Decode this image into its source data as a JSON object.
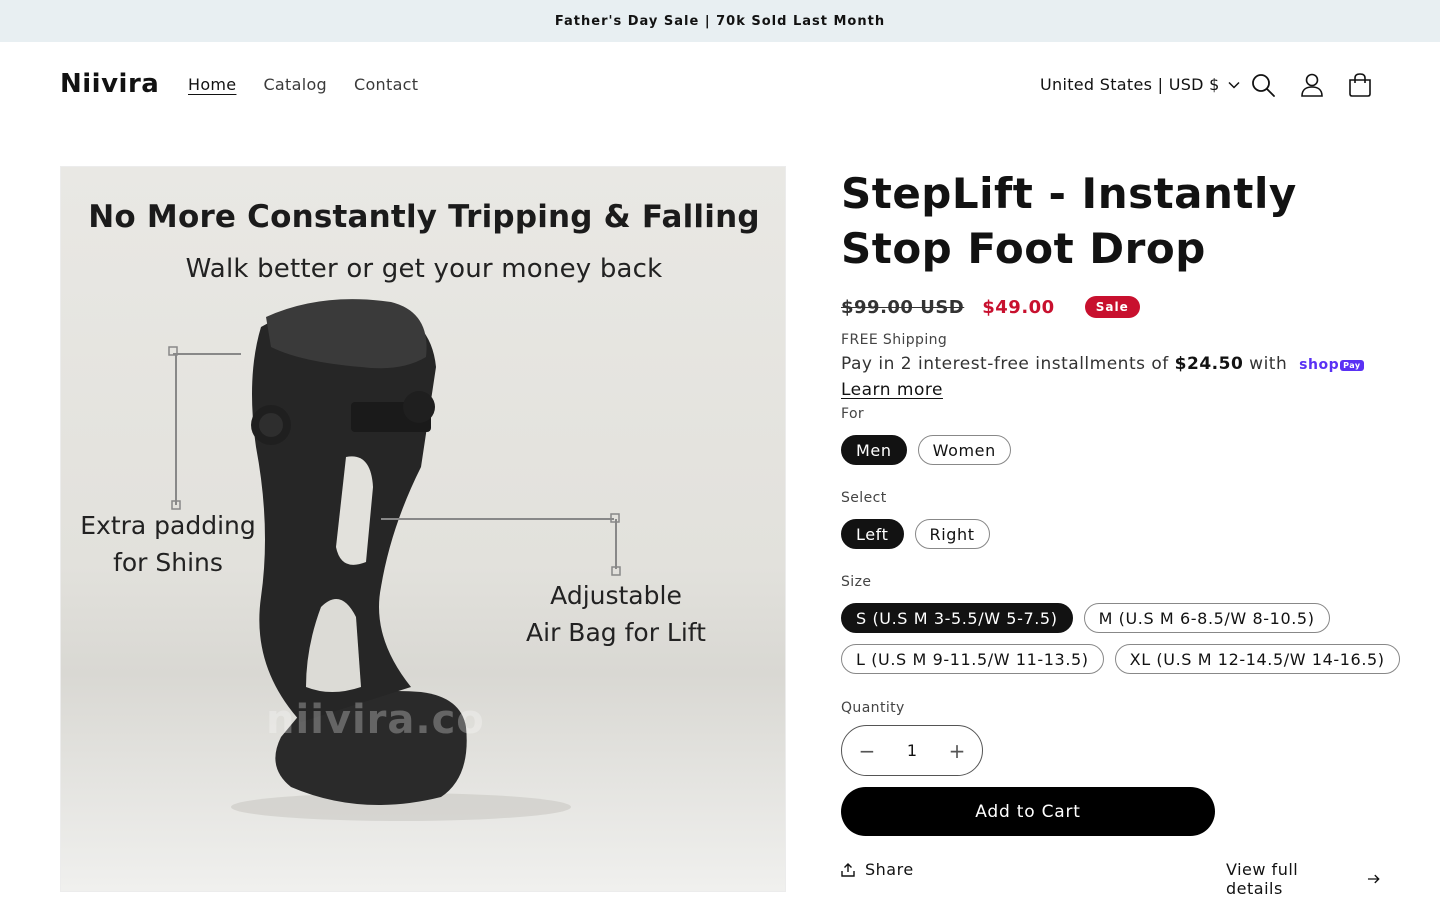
{
  "announcement": {
    "text": "Father's Day Sale | 70k Sold Last Month"
  },
  "header": {
    "logo": "Niivira",
    "nav": [
      {
        "label": "Home",
        "active": true
      },
      {
        "label": "Catalog",
        "active": false
      },
      {
        "label": "Contact",
        "active": false
      }
    ],
    "country_selector": "United States | USD $",
    "icons": [
      "search-icon",
      "account-icon",
      "cart-icon"
    ]
  },
  "media": {
    "headline": "No More Constantly Tripping & Falling",
    "subheadline": "Walk better or get your money back",
    "callout_left_line1": "Extra padding",
    "callout_left_line2": "for Shins",
    "callout_right_line1": "Adjustable",
    "callout_right_line2": "Air Bag for Lift",
    "watermark": "niivira.co"
  },
  "product": {
    "title": "StepLift - Instantly Stop Foot Drop",
    "price_regular": "$99.00 USD",
    "price_sale": "$49.00",
    "sale_badge": "Sale",
    "shipping": "FREE Shipping",
    "installments_prefix": "Pay in 2 interest-free installments of ",
    "installments_amount": "$24.50",
    "installments_suffix": " with ",
    "shoppay_label": "shop",
    "shoppay_badge": "Pay",
    "learn_more": "Learn more",
    "options": {
      "for": {
        "label": "For",
        "values": [
          "Men",
          "Women"
        ],
        "selected": "Men"
      },
      "select": {
        "label": "Select",
        "values": [
          "Left",
          "Right"
        ],
        "selected": "Left"
      },
      "size": {
        "label": "Size",
        "values": [
          "S (U.S M 3-5.5/W 5-7.5)",
          "M (U.S M 6-8.5/W 8-10.5)",
          "L (U.S M 9-11.5/W 11-13.5)",
          "XL (U.S M 12-14.5/W 14-16.5)"
        ],
        "selected": "S (U.S M 3-5.5/W 5-7.5)"
      }
    },
    "quantity_label": "Quantity",
    "quantity_value": "1",
    "add_to_cart": "Add to Cart",
    "share": "Share",
    "view_details": "View full details"
  },
  "colors": {
    "sale": "#c8102e",
    "announcement_bg": "#e8eff2",
    "button_bg": "#000000"
  }
}
